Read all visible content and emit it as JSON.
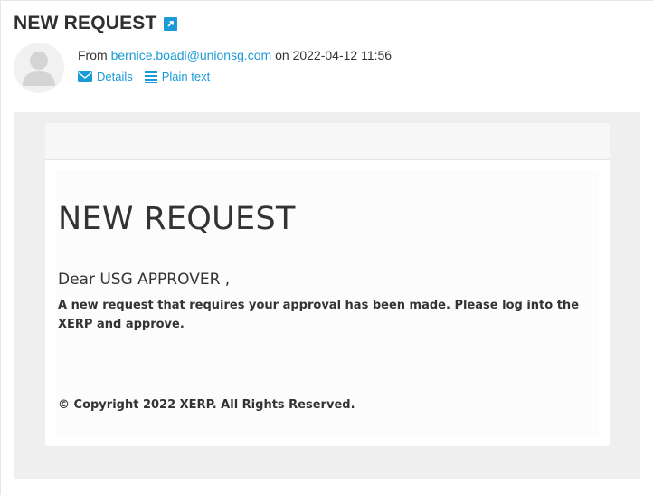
{
  "header": {
    "subject": "NEW REQUEST",
    "from_prefix": "From",
    "from_email": "bernice.boadi@unionsg.com",
    "on_label": "on",
    "datetime": "2022-04-12 11:56",
    "actions": [
      {
        "label": "Details",
        "icon": "envelope-icon"
      },
      {
        "label": "Plain text",
        "icon": "list-lines-icon"
      }
    ]
  },
  "message": {
    "title": "NEW REQUEST",
    "greeting": "Dear USG APPROVER ,",
    "body": "A new request that requires your approval has been made. Please log into the XERP and approve.",
    "copyright": "© Copyright 2022 XERP. All Rights Reserved."
  },
  "colors": {
    "link": "#1a9bd7",
    "text": "#333333",
    "message_background": "#efefef"
  }
}
